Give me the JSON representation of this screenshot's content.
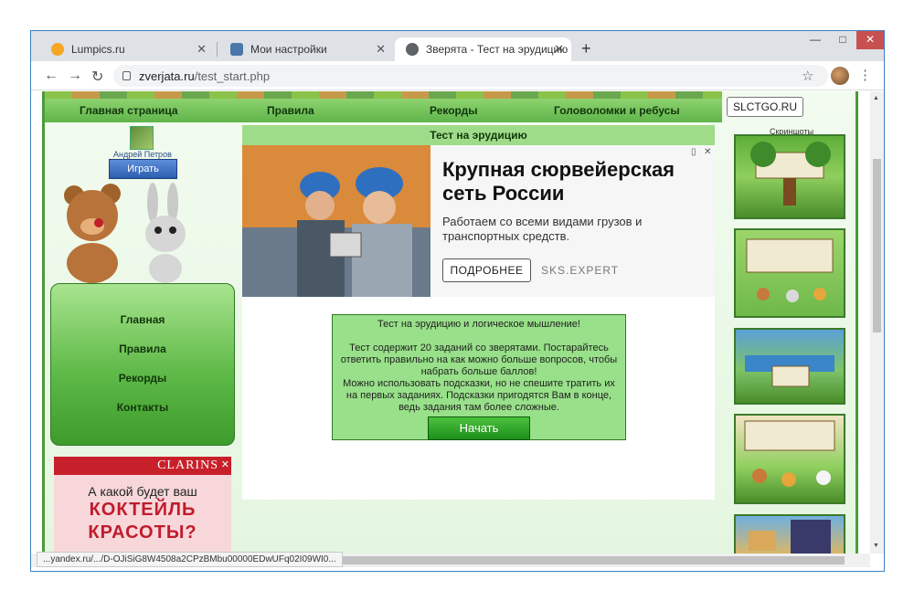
{
  "browser": {
    "tabs": [
      {
        "title": "Lumpics.ru",
        "favicon_color": "#f5a623"
      },
      {
        "title": "Мои настройки",
        "favicon_color": "#4a76a8"
      },
      {
        "title": "Зверята - Тест на эрудицию",
        "favicon_color": "#5f6368"
      }
    ],
    "new_tab_icon": "plus-icon",
    "url_host": "zverjata.ru",
    "url_path": "/test_start.php",
    "status_url": "...yandex.ru/.../D-OJiSiG8W4508a2CPzBMbu00000EDwUFq02I09WI0..."
  },
  "site": {
    "top_nav": [
      "Главная страница",
      "Правила",
      "Рекорды",
      "Головоломки и ребусы"
    ],
    "slctgo": "SLCTGO.RU",
    "screens_title": "Скриншоты",
    "user_name": "Андрей Петров",
    "play_label": "Играть",
    "side_menu": [
      "Главная",
      "Правила",
      "Рекорды",
      "Контакты"
    ],
    "clarins": {
      "brand": "CLARINS",
      "line1": "А какой будет ваш",
      "line2": "КОКТЕЙЛЬ",
      "line3": "КРАСОТЫ?"
    },
    "main_title": "Тест на эрудицию",
    "ad": {
      "title": "Крупная сюрвейерская сеть России",
      "text": "Работаем со всеми видами грузов и транспортных средств.",
      "button": "ПОДРОБНЕЕ",
      "domain": "SKS.EXPERT"
    },
    "test": {
      "heading": "Тест на эрудицию и логическое мышление!",
      "para1": "Тест содержит 20 заданий со зверятами. Постарайтесь ответить правильно на как можно больше вопросов, чтобы набрать больше баллов!",
      "para2": "Можно использовать подсказки, но не спешите тратить их на первых заданиях. Подсказки пригодятся Вам в конце, ведь задания там более сложные.",
      "start_label": "Начать"
    }
  }
}
